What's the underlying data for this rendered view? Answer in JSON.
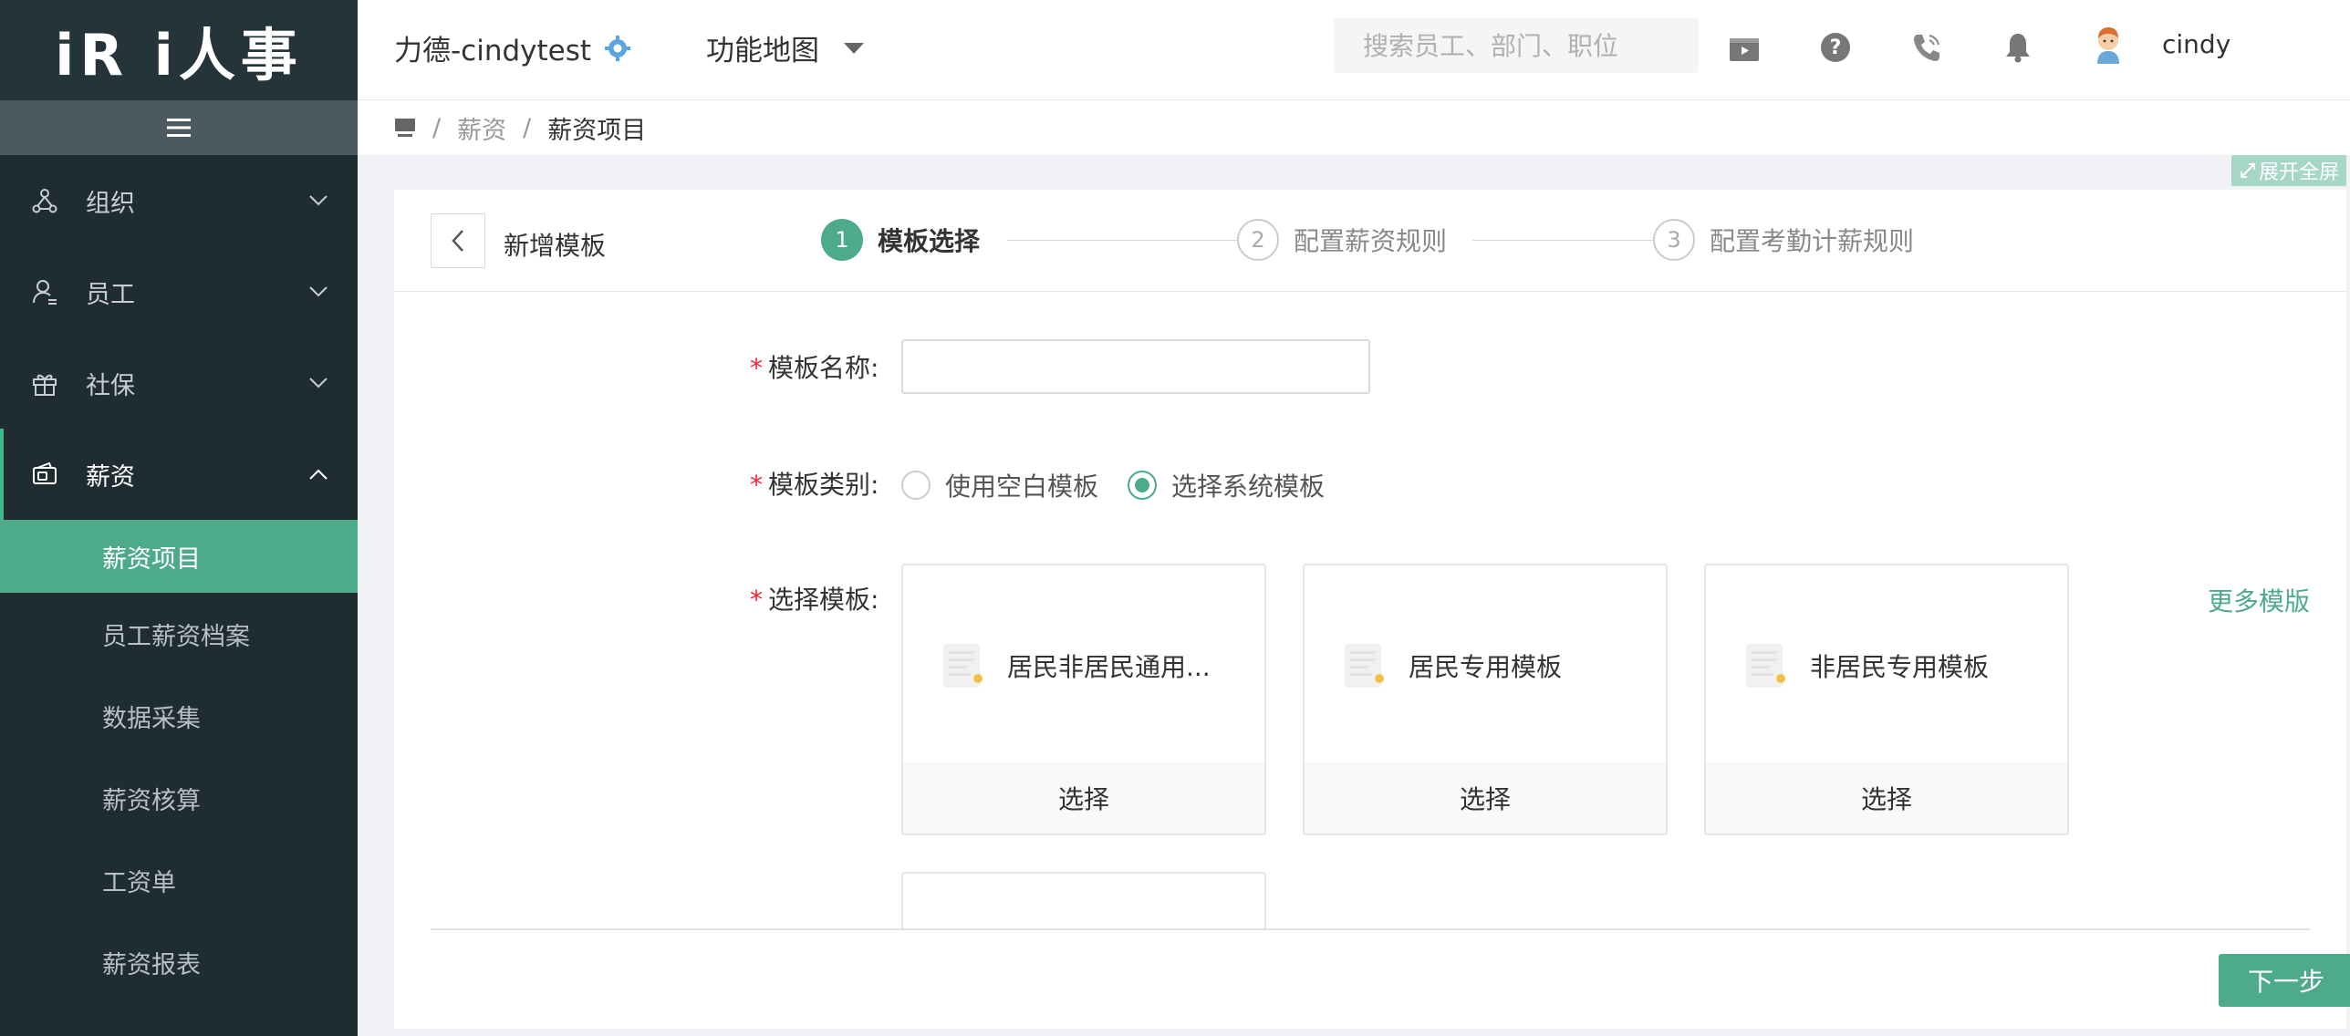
{
  "app": {
    "logo": "iR i人事"
  },
  "sidebar": {
    "collapse_icon": "hamburger-icon",
    "menu": [
      {
        "label": "组织",
        "icon": "org-icon",
        "expanded": false
      },
      {
        "label": "员工",
        "icon": "user-icon",
        "expanded": false
      },
      {
        "label": "社保",
        "icon": "gift-icon",
        "expanded": false
      },
      {
        "label": "薪资",
        "icon": "wallet-icon",
        "expanded": true
      }
    ],
    "submenu": [
      {
        "label": "薪资项目",
        "active": true
      },
      {
        "label": "员工薪资档案"
      },
      {
        "label": "数据采集"
      },
      {
        "label": "薪资核算"
      },
      {
        "label": "工资单"
      },
      {
        "label": "薪资报表"
      }
    ]
  },
  "header": {
    "company": "力德-cindytest",
    "func_map": "功能地图",
    "search_placeholder": "搜索员工、部门、职位",
    "username": "cindy"
  },
  "breadcrumb": {
    "items": [
      "薪资",
      "薪资项目"
    ]
  },
  "expand_label": "展开全屏",
  "page": {
    "title": "新增模板",
    "steps": [
      {
        "num": "1",
        "label": "模板选择",
        "active": true
      },
      {
        "num": "2",
        "label": "配置薪资规则",
        "active": false
      },
      {
        "num": "3",
        "label": "配置考勤计薪规则",
        "active": false
      }
    ],
    "form": {
      "name_label": "模板名称:",
      "name_value": "",
      "type_label": "模板类别:",
      "type_options": [
        "使用空白模板",
        "选择系统模板"
      ],
      "type_selected": "选择系统模板",
      "select_label": "选择模板:",
      "templates": [
        {
          "name": "居民非居民通用...",
          "action": "选择"
        },
        {
          "name": "居民专用模板",
          "action": "选择"
        },
        {
          "name": "非居民专用模板",
          "action": "选择"
        }
      ],
      "more_link": "更多模版"
    },
    "next_button": "下一步"
  },
  "colors": {
    "accent": "#4eab8a",
    "sidebar_bg": "#1f2d33",
    "required": "#f5222d"
  }
}
